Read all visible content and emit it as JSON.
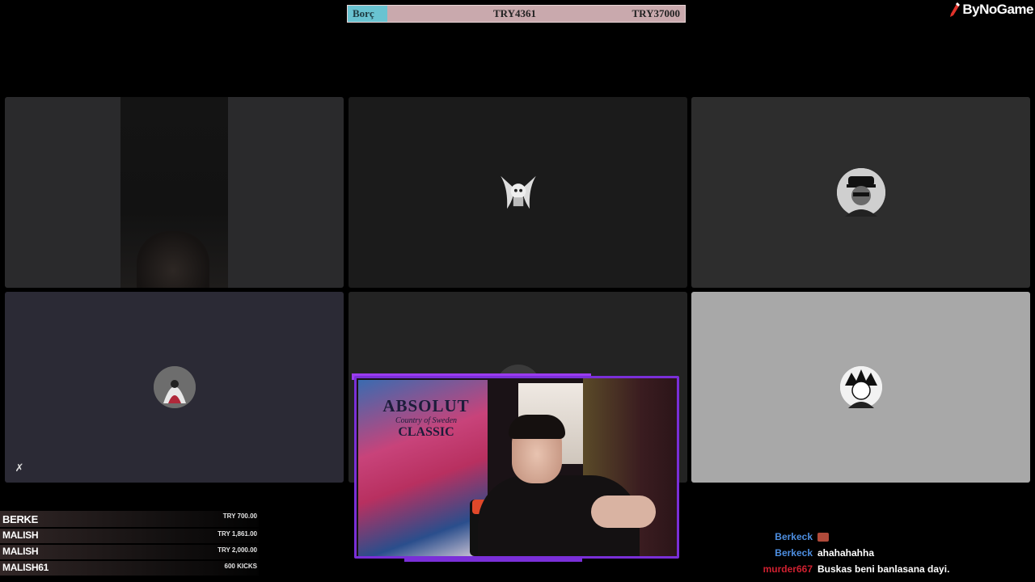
{
  "goal": {
    "label": "Borç",
    "current": "TRY4361",
    "target": "TRY37000",
    "progress": 0.118,
    "fill_color": "#69c3d1",
    "bar_color": "#c9a9ad"
  },
  "brand": {
    "name": "ByNoGame",
    "icon": "pen-icon",
    "accent": "#e0322a"
  },
  "participants": [
    {
      "type": "camera",
      "bg": "#2a2a2c"
    },
    {
      "type": "avatar",
      "icon": "winged-skull-avatar",
      "bg": "#1b1b1b"
    },
    {
      "type": "avatar",
      "icon": "rapper-avatar",
      "bg": "#2d2d2d"
    },
    {
      "type": "avatar",
      "icon": "hooded-assassin-avatar",
      "bg": "#2b2a35",
      "muted": true
    },
    {
      "type": "avatar",
      "icon": "hidden-avatar",
      "bg": "#232323"
    },
    {
      "type": "avatar",
      "icon": "manga-avatar",
      "bg": "#a8a8a8"
    }
  ],
  "webcam": {
    "border_color": "#7a2fd8",
    "poster": {
      "brand": "ABSOLUT",
      "subtitle": "Country of Sweden",
      "kind": "CLASSIC"
    }
  },
  "donations": [
    {
      "name": "BERKE",
      "amount": "TRY 700.00"
    },
    {
      "name": "MALISH",
      "amount": "TRY 1,861.00"
    },
    {
      "name": "MALISH",
      "amount": "TRY 2,000.00"
    },
    {
      "name": "MALISH61",
      "amount": "600 KICKS"
    }
  ],
  "chat": [
    {
      "user": "Berkeck",
      "user_color": "#4d8ee0",
      "message": "",
      "emote": true
    },
    {
      "user": "Berkeck",
      "user_color": "#4d8ee0",
      "message": "ahahahahha",
      "emote": false
    },
    {
      "user": "murder667",
      "user_color": "#d02030",
      "message": "Buskas beni banlasana dayi.",
      "emote": false
    }
  ]
}
